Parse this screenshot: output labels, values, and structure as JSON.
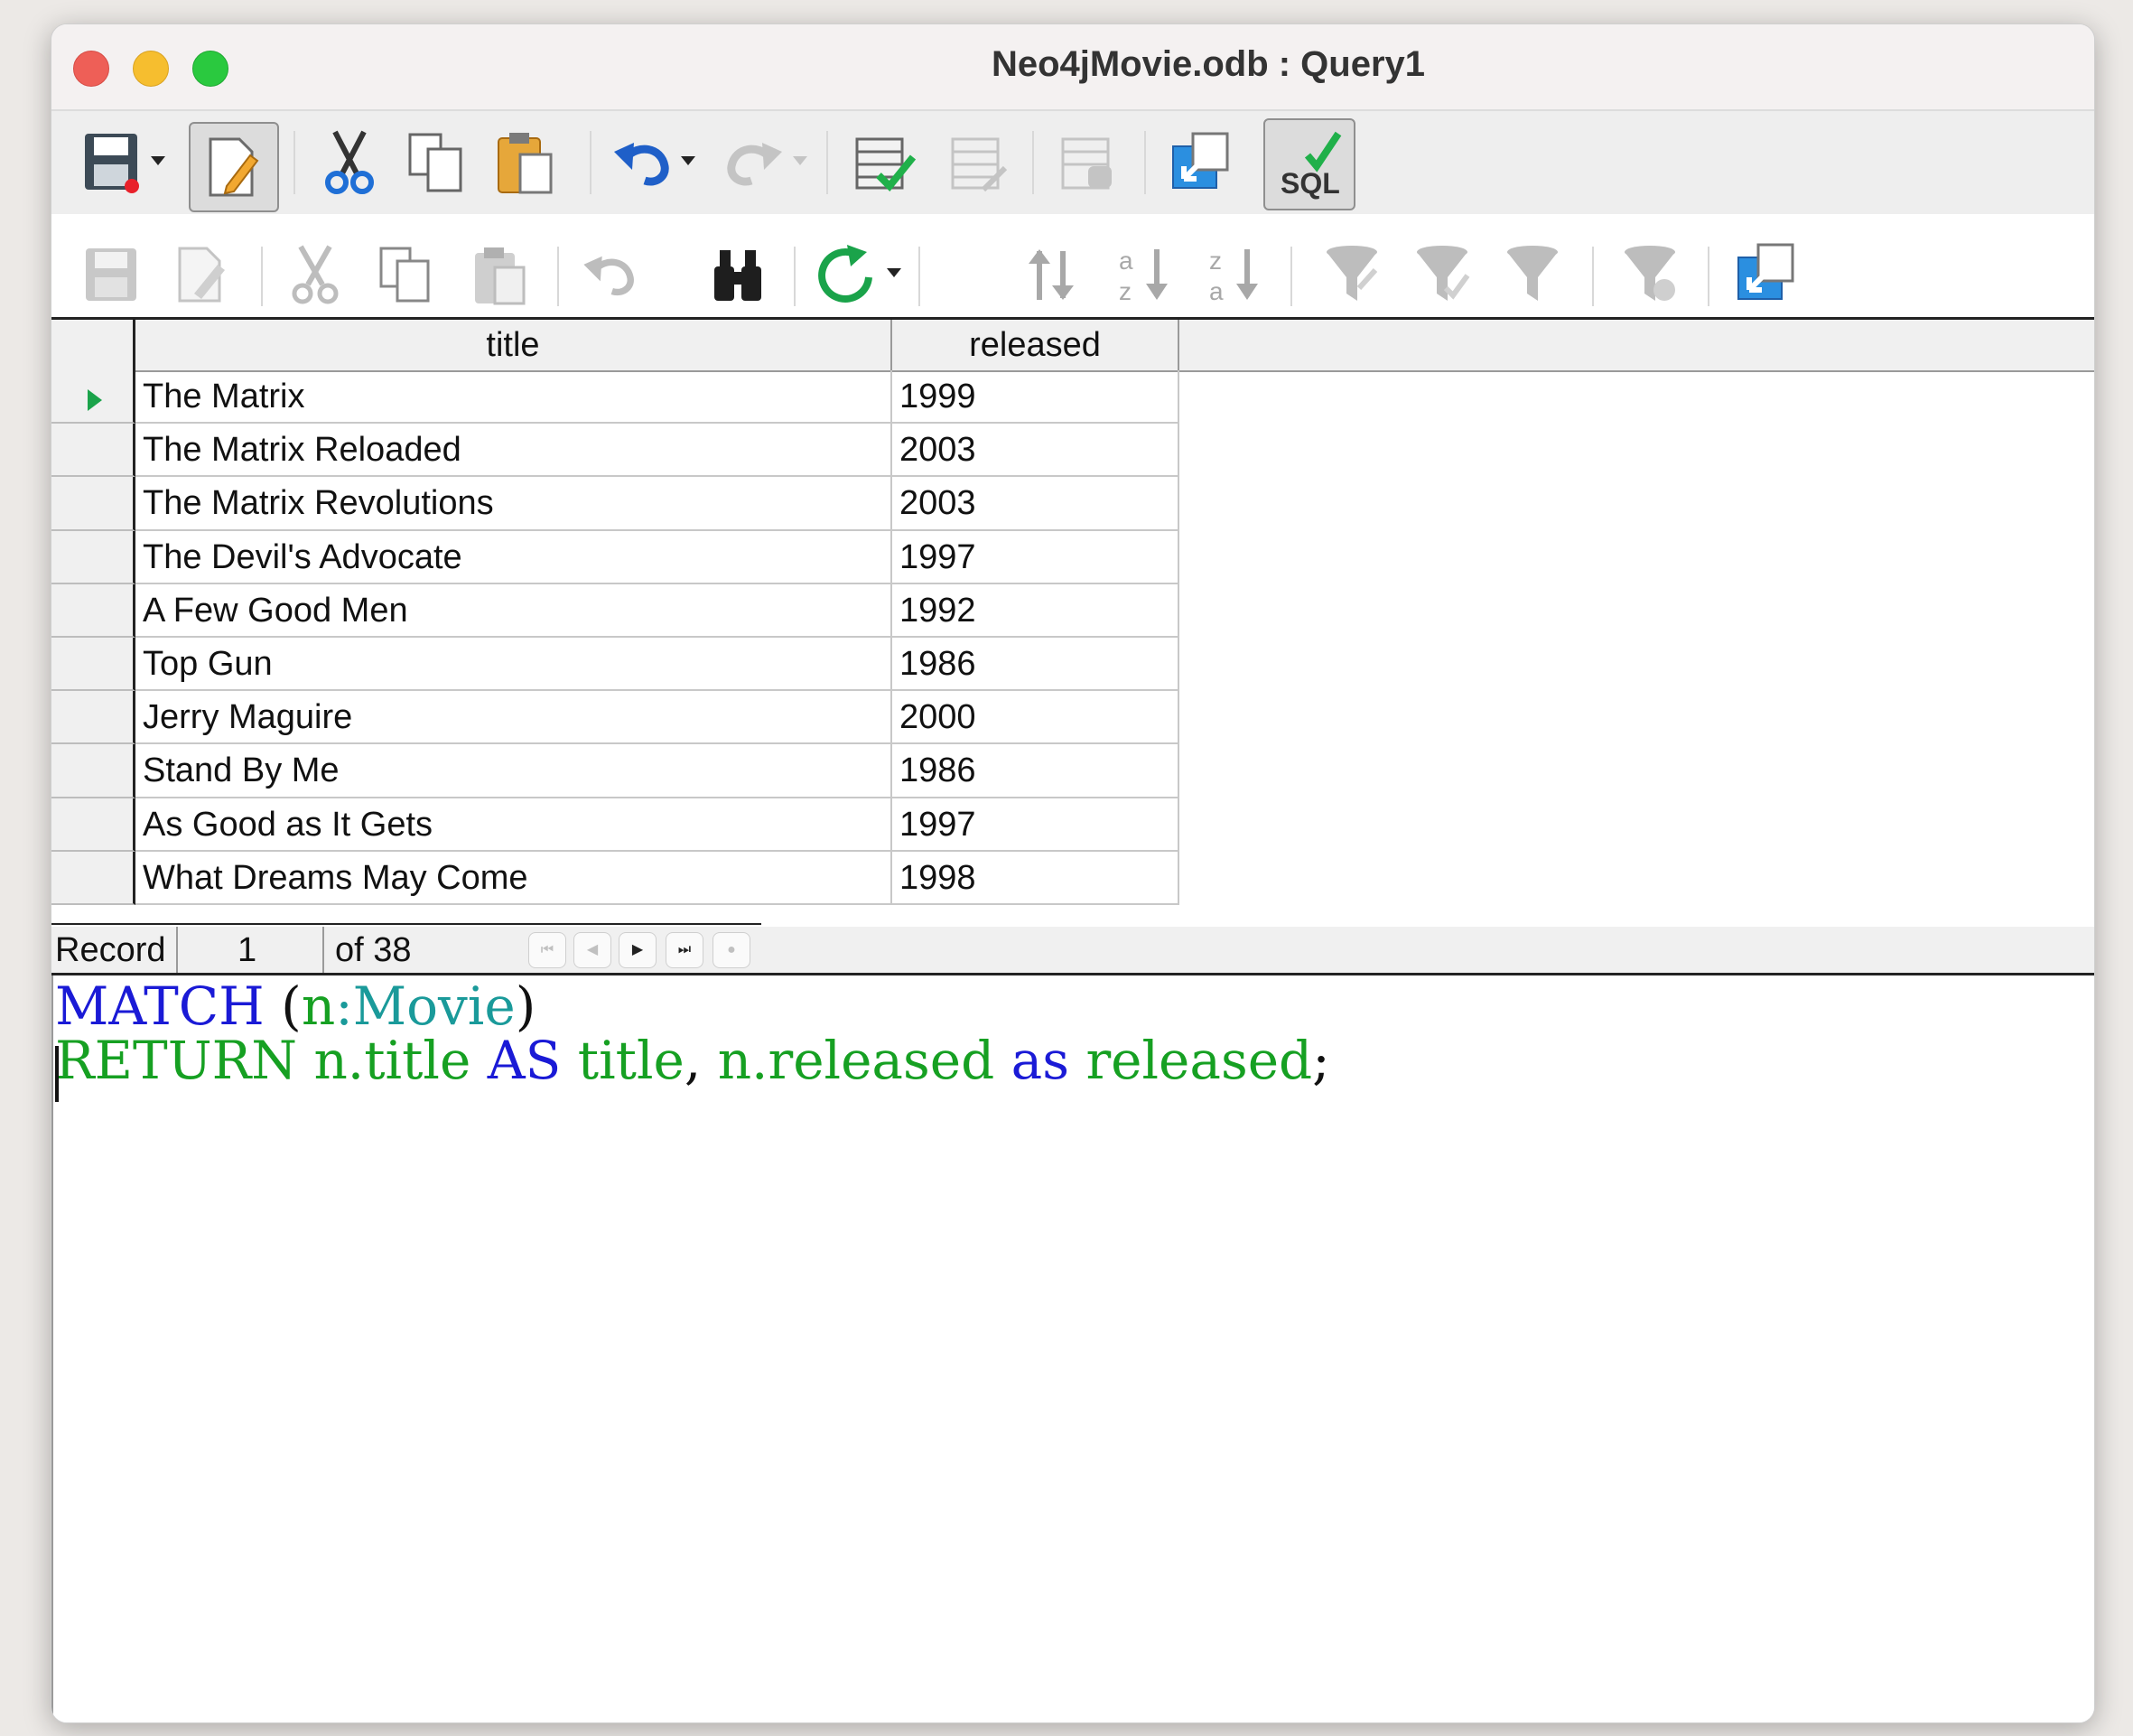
{
  "window": {
    "title": "Neo4jMovie.odb : Query1"
  },
  "toolbar_primary": {
    "items": [
      "save-icon",
      "save-dropdown-icon",
      "edit-mode-icon",
      "cut-icon",
      "copy-icon",
      "paste-icon",
      "undo-icon",
      "undo-dropdown-icon",
      "redo-icon",
      "redo-dropdown-icon",
      "run-query-icon",
      "clear-query-icon",
      "query-properties-icon",
      "switch-design-view-icon",
      "run-sql-directly-icon"
    ]
  },
  "toolbar_secondary": {
    "items": [
      "save-record-icon",
      "edit-record-icon",
      "cut-icon",
      "copy-icon",
      "paste-icon",
      "undo-icon",
      "find-record-icon",
      "refresh-icon",
      "refresh-dropdown-icon",
      "sort-icon",
      "sort-ascending-icon",
      "sort-descending-icon",
      "autofilter-icon",
      "apply-filter-icon",
      "standard-filter-icon",
      "reset-filter-icon",
      "data-to-text-icon"
    ]
  },
  "grid": {
    "columns": [
      "title",
      "released"
    ],
    "rows": [
      {
        "title": "The Matrix",
        "released": "1999"
      },
      {
        "title": "The Matrix Reloaded",
        "released": "2003"
      },
      {
        "title": "The Matrix Revolutions",
        "released": "2003"
      },
      {
        "title": "The Devil's Advocate",
        "released": "1997"
      },
      {
        "title": "A Few Good Men",
        "released": "1992"
      },
      {
        "title": "Top Gun",
        "released": "1986"
      },
      {
        "title": "Jerry Maguire",
        "released": "2000"
      },
      {
        "title": "Stand By Me",
        "released": "1986"
      },
      {
        "title": "As Good as It Gets",
        "released": "1997"
      },
      {
        "title": "What Dreams May Come",
        "released": "1998"
      }
    ]
  },
  "record_nav": {
    "label": "Record",
    "current": "1",
    "total_text": "of 38"
  },
  "editor": {
    "line1": {
      "kw": "MATCH",
      "open": " (",
      "var": "n",
      "colon": ":",
      "label": "Movie",
      "close": ")"
    },
    "line2": {
      "kw1": "RETURN",
      "expr1": "n.title",
      "kw2": "AS",
      "alias1": "title",
      "comma": ",",
      "expr2": "n.released",
      "kw3": "as",
      "alias2": "released",
      "semi": ";"
    }
  },
  "colors": {
    "keyword": "#1a1ad6",
    "identifier": "#16a022",
    "label": "#1a9a9a"
  }
}
